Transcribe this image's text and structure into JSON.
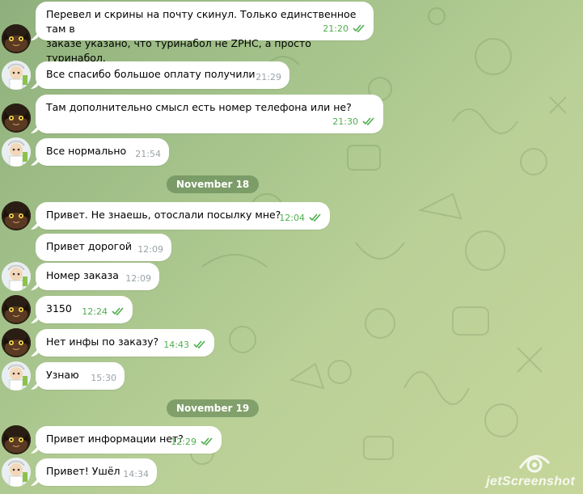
{
  "messages": [
    {
      "who": "cat",
      "lines": [
        "Перевел и скрины на почту скинул. Только единственное там в",
        "заказе указано, что туринабол не ZPHC, а просто туринабол."
      ],
      "time": "21:20",
      "read": true
    },
    {
      "who": "doc",
      "lines": [
        "Все спасибо большое оплату получили"
      ],
      "time": "21:29",
      "read": false
    },
    {
      "who": "cat",
      "lines": [
        "Там дополнительно смысл есть номер телефона или не?"
      ],
      "time": "21:30",
      "read": true
    },
    {
      "who": "doc",
      "lines": [
        "Все нормально"
      ],
      "time": "21:54",
      "read": false
    },
    {
      "who": "cat",
      "lines": [
        "Привет. Не знаешь, отослали посылку мне?"
      ],
      "time": "12:04",
      "read": true
    },
    {
      "who": "doc",
      "lines": [
        "Привет дорогой"
      ],
      "time": "12:09",
      "read": false
    },
    {
      "who": "doc",
      "lines": [
        "Номер заказа"
      ],
      "time": "12:09",
      "read": false
    },
    {
      "who": "cat",
      "lines": [
        "3150"
      ],
      "time": "12:24",
      "read": true
    },
    {
      "who": "cat",
      "lines": [
        "Нет инфы по заказу?"
      ],
      "time": "14:43",
      "read": true
    },
    {
      "who": "doc",
      "lines": [
        "Узнаю"
      ],
      "time": "15:30",
      "read": false
    },
    {
      "who": "cat",
      "lines": [
        "Привет информации нет?"
      ],
      "time": "12:29",
      "read": true
    },
    {
      "who": "doc",
      "lines": [
        "Привет! Ушёл"
      ],
      "time": "14:34",
      "read": false
    }
  ],
  "dates": [
    "November 18",
    "November 19"
  ],
  "watermark": "jetScreenshot",
  "colors": {
    "bubble": "#ffffff",
    "time_out": "#4fae4e",
    "time_in": "#9aa3a8",
    "date_pill": "#60825099"
  }
}
